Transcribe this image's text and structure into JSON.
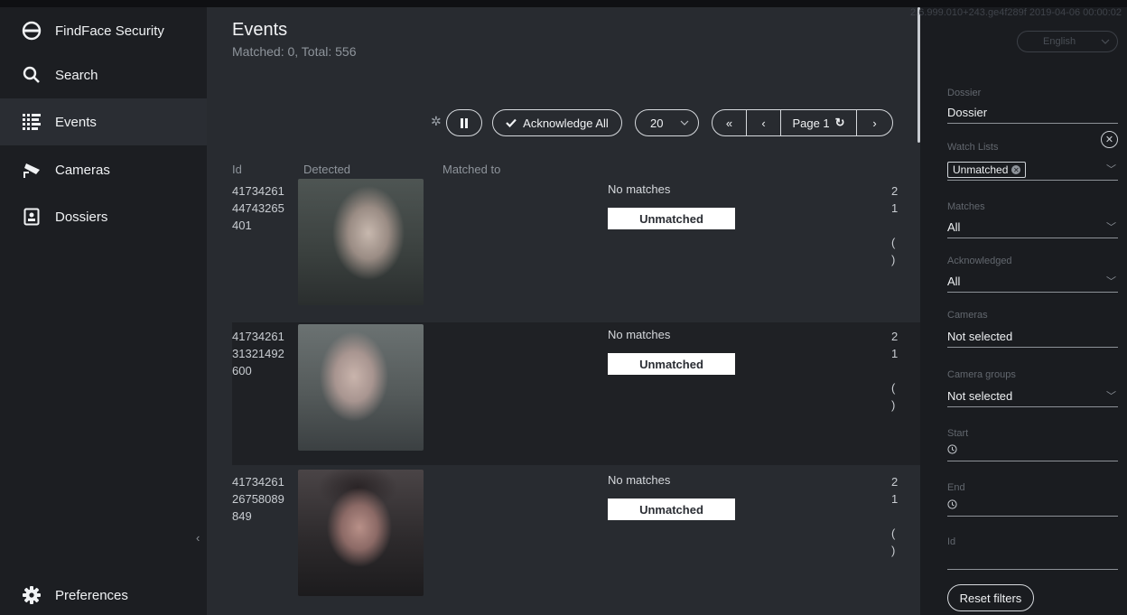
{
  "app": {
    "name": "FindFace Security",
    "version": "2.6.999.010+243.ge4f289f 2019-04-06 00:00:02"
  },
  "sidebar": {
    "items": [
      {
        "label": "Search",
        "icon": "search-icon"
      },
      {
        "label": "Events",
        "icon": "events-list-icon",
        "active": true
      },
      {
        "label": "Cameras",
        "icon": "camera-icon"
      },
      {
        "label": "Dossiers",
        "icon": "dossier-icon"
      }
    ],
    "preferences_label": "Preferences",
    "collapse_glyph": "‹"
  },
  "page": {
    "title": "Events",
    "subtitle": "Matched: 0, Total: 556"
  },
  "toolbar": {
    "acknowledge_label": "Acknowledge All",
    "page_size": "20",
    "first_glyph": "«",
    "prev_glyph": "‹",
    "page_label": "Page 1",
    "next_glyph": "›"
  },
  "table": {
    "columns": [
      "Id",
      "Detected",
      "Matched to"
    ],
    "rows": [
      {
        "id": "4173426144743265401",
        "match_text": "No matches",
        "status": "Unmatched",
        "trunc": "2\n1\n\n(\n)"
      },
      {
        "id": "4173426131321492600",
        "match_text": "No matches",
        "status": "Unmatched",
        "trunc": "2\n1\n\n(\n)"
      },
      {
        "id": "4173426126758089849",
        "match_text": "No matches",
        "status": "Unmatched",
        "trunc": "2\n1\n\n(\n)"
      }
    ]
  },
  "filters": {
    "language": "English",
    "dossier_label": "Dossier",
    "dossier_value": "Dossier",
    "watch_lists_label": "Watch Lists",
    "watch_lists_chip": "Unmatched",
    "matches_label": "Matches",
    "matches_value": "All",
    "acknowledged_label": "Acknowledged",
    "acknowledged_value": "All",
    "cameras_label": "Cameras",
    "cameras_value": "Not selected",
    "camera_groups_label": "Camera groups",
    "camera_groups_value": "Not selected",
    "start_label": "Start",
    "end_label": "End",
    "id_label": "Id",
    "reset_label": "Reset filters"
  },
  "colors": {
    "sidebar_bg": "#1c1e22",
    "main_bg": "#282b30",
    "filters_bg": "#1a1c20",
    "tag_bg": "#ffffff"
  }
}
